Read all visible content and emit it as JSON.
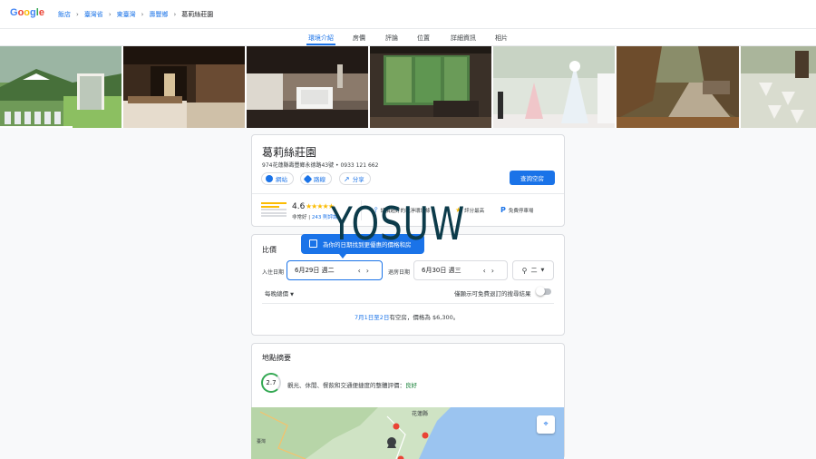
{
  "brand": {
    "logo_letters": [
      "G",
      "o",
      "o",
      "g",
      "l",
      "e"
    ],
    "logo_colors": [
      "#4285f4",
      "#ea4335",
      "#fbbc05",
      "#4285f4",
      "#34a853",
      "#ea4335"
    ]
  },
  "breadcrumb": {
    "items": [
      "飯店",
      "臺灣省",
      "東臺灣",
      "壽豐鄉",
      "葛莉絲莊園"
    ],
    "separator": "›"
  },
  "tabs": [
    "環境介紹",
    "房價",
    "評論",
    "位置",
    "詳細資訊",
    "相片"
  ],
  "active_tab": "環境介紹",
  "hotel": {
    "name": "葛莉絲莊園",
    "address": "974花蓮縣壽豐鄉永德路43號 • 0933 121 662",
    "actions": [
      "網站",
      "路線",
      "分享"
    ],
    "check_button": "查詢空房",
    "rating": "4.6",
    "stars": "★★★★★",
    "rating_word": "非常好",
    "reviews_link": "243 則評論",
    "amenities": [
      "評價超好的乾淨環境條",
      "評分最高",
      "免費停車場"
    ]
  },
  "watermark": "YOSUW",
  "pricing": {
    "title": "比價",
    "tooltip": "為你的日期找到更優惠的價格和房",
    "checkin_label": "入住日期",
    "checkin_value": "6月29日 週二",
    "checkout_label": "退房日期",
    "checkout_value": "6月30日 週三",
    "guests": "二",
    "price_mode": "每晚總價",
    "filter_label": "僅顯示可免費退訂的搜尋結果",
    "availability_dates": "7月1日至2日",
    "availability_rest": "有空房，價格為 $6,300。"
  },
  "location": {
    "title": "地點摘要",
    "score": "2.7",
    "score_text": "觀光、休閒、餐飲和交通便捷度的整體評價：",
    "score_word": "良好",
    "map_label": "花蓮縣",
    "map_place": "臺灣"
  },
  "colors": {
    "accent": "#1a73e8",
    "star": "#fbbc04",
    "good": "#188038"
  }
}
